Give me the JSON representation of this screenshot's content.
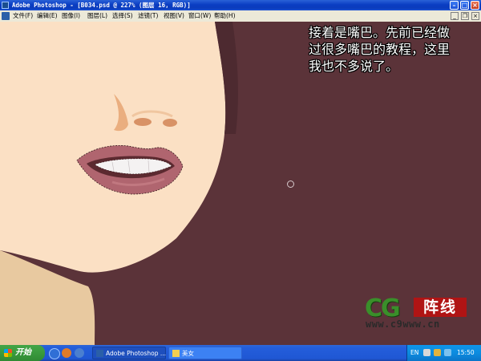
{
  "window": {
    "title": "Adobe Photoshop - [B034.psd @ 227% (图层 16, RGB)]"
  },
  "menu": {
    "items": [
      "文件(F)",
      "编辑(E)",
      "图像(I)",
      "图层(L)",
      "选择(S)",
      "滤镜(T)",
      "视图(V)",
      "窗口(W)",
      "帮助(H)"
    ]
  },
  "canvas": {
    "caption": "接着是嘴巴。先前已经做过很多嘴巴的教程，这里我也不多说了。"
  },
  "logo": {
    "cg_text": "CG",
    "zhen_text": "阵线",
    "url_text": "www.c9www.cn"
  },
  "taskbar": {
    "start_label": "开始",
    "tasks": [
      {
        "label": "Adobe Photoshop ..."
      },
      {
        "label": "美女"
      }
    ],
    "tray": {
      "lang": "EN",
      "time": "15:50"
    }
  },
  "colors": {
    "canvas_bg": "#5b3339",
    "skin": "#fbe0c4",
    "lips": "#b0656f"
  }
}
